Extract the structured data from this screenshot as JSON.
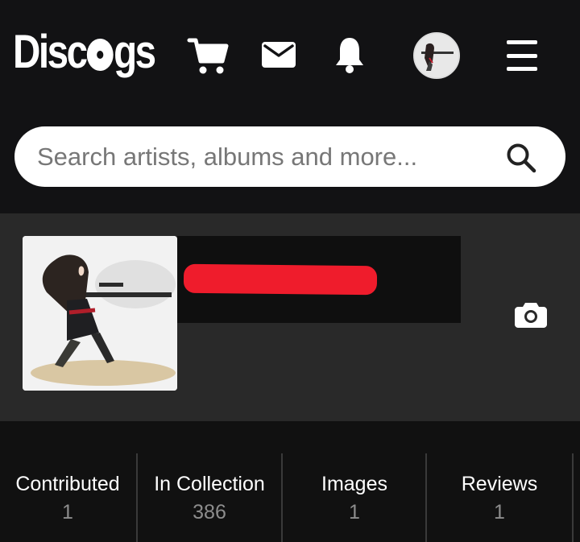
{
  "header": {
    "logo_text": "Discogs",
    "cart_icon": "shopping-cart-icon",
    "mail_icon": "envelope-icon",
    "bell_icon": "notification-bell-icon",
    "menu_icon": "hamburger-menu-icon"
  },
  "search": {
    "placeholder": "Search artists, albums and more...",
    "icon": "search-icon"
  },
  "profile": {
    "camera_icon": "camera-icon"
  },
  "stats": [
    {
      "label": "Contributed",
      "value": "1"
    },
    {
      "label": "In Collection",
      "value": "386"
    },
    {
      "label": "Images",
      "value": "1"
    },
    {
      "label": "Reviews",
      "value": "1"
    }
  ],
  "colors": {
    "header_bg": "#121214",
    "profile_bg": "#292929",
    "redaction": "#ef1c2c",
    "stat_value": "#8d8d8d"
  }
}
